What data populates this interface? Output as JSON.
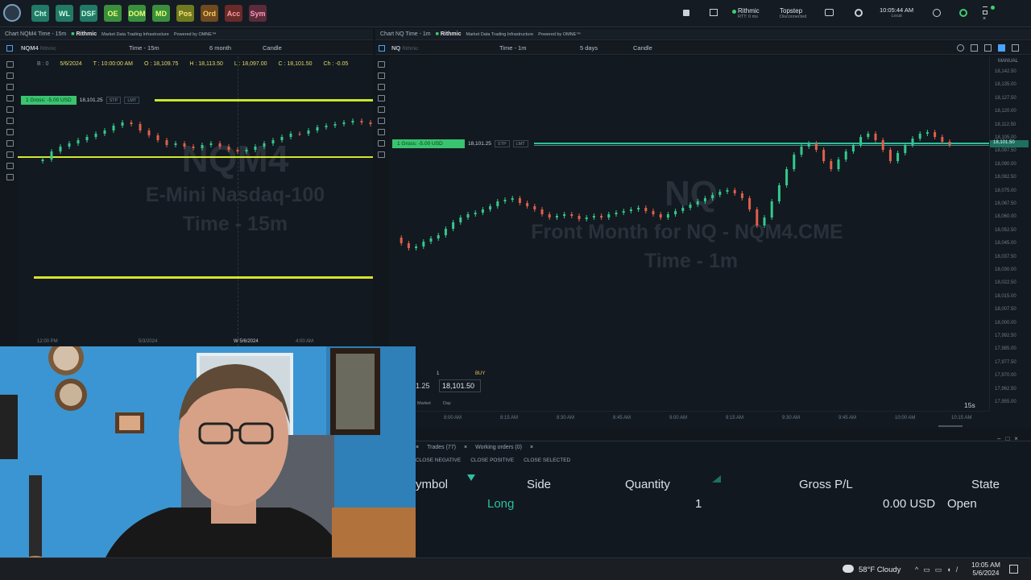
{
  "topbar": {
    "buttons": [
      {
        "label": "Cht",
        "style": "teal"
      },
      {
        "label": "WL",
        "style": "teal"
      },
      {
        "label": "DSF",
        "style": "teal"
      },
      {
        "label": "OE",
        "style": "green"
      },
      {
        "label": "DOM",
        "style": "green"
      },
      {
        "label": "MD",
        "style": "green"
      },
      {
        "label": "Pos",
        "style": "olive"
      },
      {
        "label": "Ord",
        "style": "brown"
      },
      {
        "label": "Acc",
        "style": "red"
      },
      {
        "label": "Sym",
        "style": "maroon"
      }
    ],
    "rithmic": {
      "name": "Rithmic",
      "sub": "RTT: 0 ms"
    },
    "topstep": {
      "name": "Topstep",
      "sub": "Disconnected"
    },
    "clock": {
      "time": "10:05:44 AM",
      "sub": "Local"
    }
  },
  "left_chart": {
    "window_title": "Chart NQM4 Time - 15m",
    "brand": "Rithmic",
    "brand_sub": "Market Data Trading Infrastructure",
    "powered": "Powered by OMNE™",
    "symbol": "NQM4",
    "symbol_sub": "Rithmic",
    "interval": "Time - 15m",
    "range": "6 month",
    "style": "Candle",
    "status_b": "B : 0",
    "status_date": "5/6/2024",
    "status_time": "T : 10:00:00 AM",
    "status_open": "O : 18,109.75",
    "status_high": "H : 18,113.50",
    "status_low": "L : 18,097.00",
    "status_close": "C : 18,101.50",
    "status_chg": "Ch : -0.05",
    "watermark_symbol": "NQM4",
    "watermark_name": "E-Mini Nasdaq-100",
    "watermark_interval": "Time - 15m",
    "order_tag": "1 Gross: -5.00 USD",
    "order_price": "18,101.25",
    "order_stp": "STP",
    "order_lmt": "LMT",
    "x_ticks": [
      "12:00 PM",
      "5/3/2024",
      "W 5/6/2024",
      "4:00 AM"
    ]
  },
  "right_chart": {
    "window_title": "Chart NQ Time - 1m",
    "brand": "Rithmic",
    "brand_sub": "Market Data Trading Infrastructure",
    "powered": "Powered by OMNE™",
    "symbol": "NQ",
    "symbol_sub": "Rithmic",
    "interval": "Time - 1m",
    "range": "5 days",
    "style": "Candle",
    "watermark_symbol": "NQ",
    "watermark_name": "Front Month for NQ - NQM4.CME",
    "watermark_interval": "Time - 1m",
    "order_tag": "1 Gross: -5.00 USD",
    "order_price": "18,101.25",
    "order_stp": "STP",
    "order_lmt": "LMT",
    "manual_label": "MANUAL",
    "current_price_label": "18,101.50",
    "y_ticks": [
      "18,142.50",
      "18,135.00",
      "18,127.50",
      "18,120.00",
      "18,112.50",
      "18,105.00",
      "18,097.50",
      "18,090.00",
      "18,082.50",
      "18,075.00",
      "18,067.50",
      "18,060.00",
      "18,052.50",
      "18,045.00",
      "18,037.50",
      "18,030.00",
      "18,022.50",
      "18,015.00",
      "18,007.50",
      "18,000.00",
      "17,992.50",
      "17,985.00",
      "17,977.50",
      "17,970.00",
      "17,962.50",
      "17,955.00"
    ],
    "x_ticks": [
      "8:00 AM",
      "8:15 AM",
      "8:30 AM",
      "8:45 AM",
      "9:00 AM",
      "9:15 AM",
      "9:30 AM",
      "9:45 AM",
      "10:00 AM",
      "10:15 AM"
    ],
    "timer": "15s",
    "order_entry": {
      "qty": "1",
      "side": "BUY",
      "price_left": "1.25",
      "price": "18,101.50",
      "mode_market": "Market",
      "mode_day": "Day"
    }
  },
  "trades": {
    "tab_trades": "Trades (77)",
    "tab_working": "Working orders (0)",
    "actions": [
      "CLOSE NEGATIVE",
      "CLOSE POSITIVE",
      "CLOSE SELECTED"
    ],
    "headers": {
      "symbol": "ymbol",
      "side": "Side",
      "quantity": "Quantity",
      "gross": "Gross P/L",
      "state": "State"
    },
    "row": {
      "side": "Long",
      "quantity": "1",
      "gross": "0.00 USD",
      "state": "Open"
    }
  },
  "taskbar": {
    "weather": "58°F  Cloudy",
    "time": "10:05 AM",
    "date": "5/6/2024"
  }
}
